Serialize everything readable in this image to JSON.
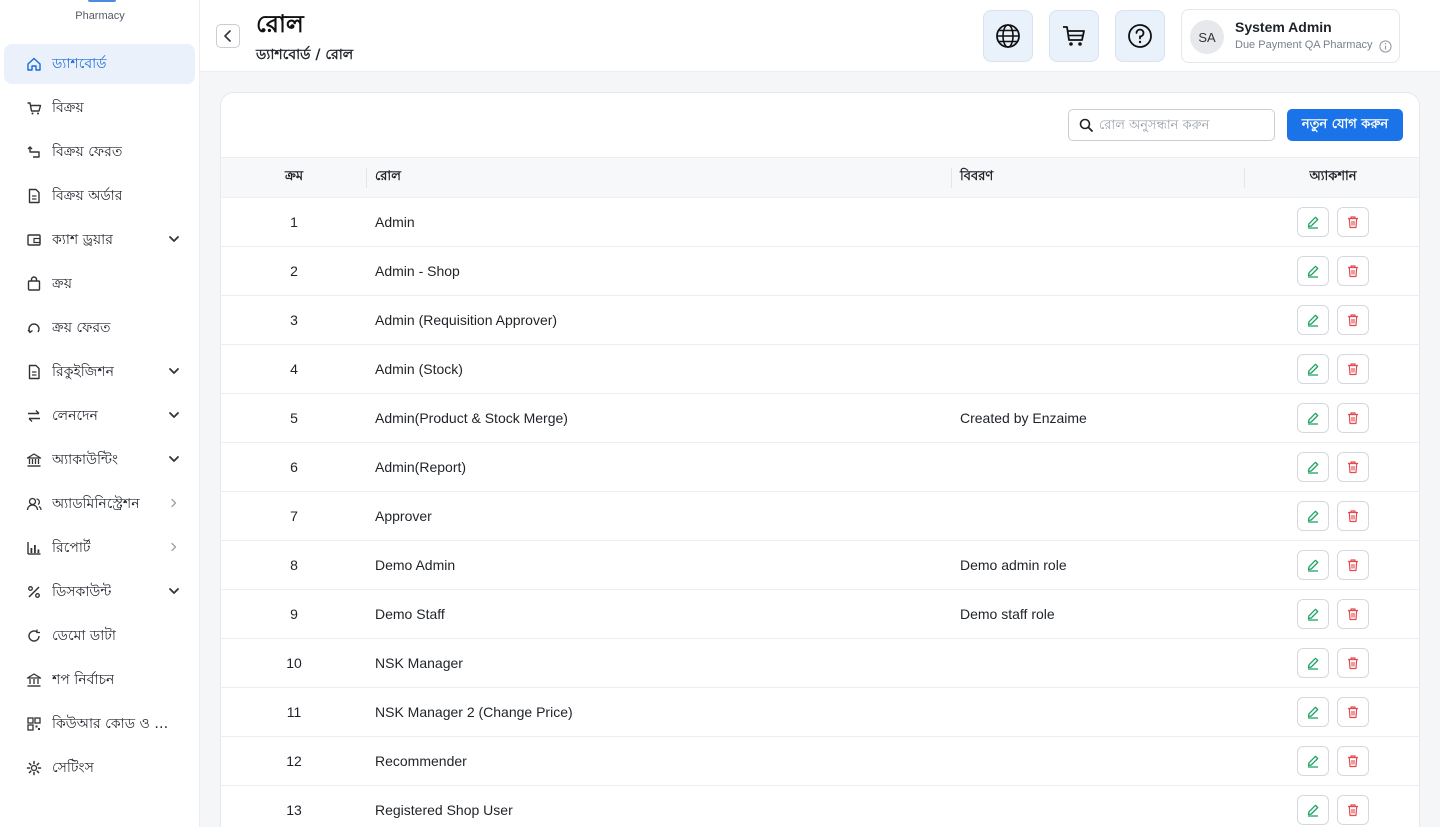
{
  "brand": {
    "subtitle": "Pharmacy"
  },
  "sidebar": {
    "items": [
      {
        "label": "ড্যাশবোর্ড",
        "icon": "home-icon",
        "active": true
      },
      {
        "label": "বিক্রয়",
        "icon": "cart-icon"
      },
      {
        "label": "বিক্রয় ফেরত",
        "icon": "return-icon"
      },
      {
        "label": "বিক্রয় অর্ডার",
        "icon": "document-icon"
      },
      {
        "label": "ক্যাশ ড্রয়ার",
        "icon": "wallet-icon",
        "chevron": "down"
      },
      {
        "label": "ক্রয়",
        "icon": "bag-icon"
      },
      {
        "label": "ক্রয় ফেরত",
        "icon": "undo-icon"
      },
      {
        "label": "রিকুইজিশন",
        "icon": "document-icon",
        "chevron": "down"
      },
      {
        "label": "লেনদেন",
        "icon": "transfer-icon",
        "chevron": "down"
      },
      {
        "label": "অ্যাকাউন্টিং",
        "icon": "bank-icon",
        "chevron": "down"
      },
      {
        "label": "অ্যাডমিনিস্ট্রেশন",
        "icon": "users-icon",
        "chevron": "right"
      },
      {
        "label": "রিপোর্ট",
        "icon": "chart-icon",
        "chevron": "right"
      },
      {
        "label": "ডিসকাউন্ট",
        "icon": "percent-icon",
        "chevron": "down"
      },
      {
        "label": "ডেমো ডাটা",
        "icon": "refresh-icon"
      },
      {
        "label": "শপ নির্বাচন",
        "icon": "shop-icon"
      },
      {
        "label": "কিউআর কোড ও মা...",
        "icon": "qrcode-icon"
      },
      {
        "label": "সেটিংস",
        "icon": "gear-icon"
      }
    ]
  },
  "header": {
    "title": "রোল",
    "breadcrumb": "ড্যাশবোর্ড / রোল",
    "user": {
      "initials": "SA",
      "name": "System Admin",
      "org": "Due Payment QA Pharmacy"
    }
  },
  "toolbar": {
    "search_placeholder": "রোল অনুসন্ধান করুন",
    "add_label": "নতুন যোগ করুন"
  },
  "table": {
    "columns": [
      "ক্রম",
      "রোল",
      "বিবরণ",
      "অ্যাকশান"
    ],
    "rows": [
      {
        "serial": "1",
        "role": "Admin",
        "description": ""
      },
      {
        "serial": "2",
        "role": "Admin - Shop",
        "description": ""
      },
      {
        "serial": "3",
        "role": "Admin (Requisition Approver)",
        "description": ""
      },
      {
        "serial": "4",
        "role": "Admin (Stock)",
        "description": ""
      },
      {
        "serial": "5",
        "role": "Admin(Product & Stock Merge)",
        "description": "Created by Enzaime"
      },
      {
        "serial": "6",
        "role": "Admin(Report)",
        "description": ""
      },
      {
        "serial": "7",
        "role": "Approver",
        "description": ""
      },
      {
        "serial": "8",
        "role": "Demo Admin",
        "description": "Demo admin role"
      },
      {
        "serial": "9",
        "role": "Demo Staff",
        "description": "Demo staff role"
      },
      {
        "serial": "10",
        "role": "NSK Manager",
        "description": ""
      },
      {
        "serial": "11",
        "role": "NSK Manager 2 (Change Price)",
        "description": ""
      },
      {
        "serial": "12",
        "role": "Recommender",
        "description": ""
      },
      {
        "serial": "13",
        "role": "Registered Shop User",
        "description": ""
      }
    ]
  },
  "colors": {
    "primary": "#1a73e8",
    "active_bg": "#eaf1fb",
    "edit": "#1fa463",
    "delete": "#e5484d"
  }
}
